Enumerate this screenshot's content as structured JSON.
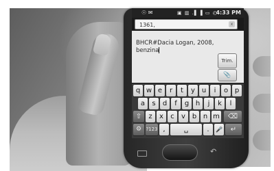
{
  "status_bar": {
    "left_icons": "☉ ✉",
    "right_icons": "▣ ▥ .▌▐ ▭ ◴",
    "time": "4:33 PM"
  },
  "compose": {
    "recipient": "1361,",
    "recipient_clear_icon": "x",
    "message_lines": [
      "BHCR#Dacia Logan, 2008,",
      "benzina"
    ],
    "send_button_label": "Trim.",
    "attach_icon": "📎"
  },
  "keyboard": {
    "row1": [
      "q",
      "w",
      "e",
      "r",
      "t",
      "y",
      "u",
      "i",
      "o",
      "p"
    ],
    "row2": [
      "a",
      "s",
      "d",
      "f",
      "g",
      "h",
      "j",
      "k",
      "l"
    ],
    "row3": [
      "⇧",
      "z",
      "x",
      "c",
      "v",
      "b",
      "n",
      "m",
      "⌫"
    ],
    "row4": [
      "⚙",
      "?123",
      ",",
      "␣",
      ".",
      "🎤",
      "↵"
    ]
  },
  "hardware": {
    "menu_icon": "menu-icon",
    "back_icon": "↶"
  }
}
